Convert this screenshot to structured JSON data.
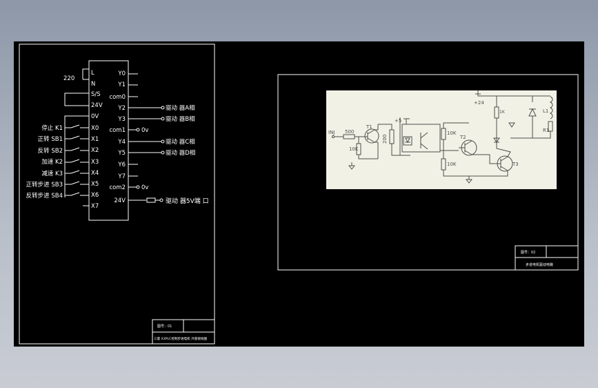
{
  "plc": {
    "supply": "220",
    "inputs_left": [
      "L",
      "N",
      "S/S",
      "24V",
      "0V",
      "X0",
      "X1",
      "X2",
      "X3",
      "X4",
      "X5",
      "X6",
      "X7"
    ],
    "outputs_right": [
      "Y0",
      "Y1",
      "com0",
      "Y2",
      "Y3",
      "com1",
      "Y4",
      "Y5",
      "Y6",
      "Y7",
      "com2",
      "24V"
    ],
    "switches": [
      "停止 K1",
      "正转 SB1",
      "反转 SB2",
      "加速 K2",
      "减速 K3",
      "正转步进 SB3",
      "反转步进 SB4"
    ],
    "out_phase_a": "驱动 器A相",
    "out_phase_b": "驱动 器B相",
    "out_ov1": "0v",
    "out_phase_c": "驱动 器C相",
    "out_phase_d": "驱动 器D相",
    "out_ov2": "0v",
    "out_5v": "驱动 器5V端 口"
  },
  "title_block_left": {
    "sheet": "图号：01",
    "caption": "三菱 X3PLC控制步进电机 外部接线图"
  },
  "driver": {
    "inj": "INJ",
    "r500": "500",
    "r200": "200",
    "r10k_a": "10K",
    "r10k_b": "10K",
    "r10k_c": "10K",
    "plus5": "+5",
    "plus24": "+24",
    "t1": "T1",
    "t2": "T2",
    "t3": "T3",
    "l1": "L1",
    "r1": "R1",
    "rk": "1K"
  },
  "title_block_right": {
    "sheet": "图号：02",
    "caption": "步进电机驱动电路"
  },
  "colors": {
    "background": "#000000",
    "lines": "#ffffff",
    "photo_bg": "#f1f1e6",
    "photo_ink": "#4a4f4a"
  }
}
